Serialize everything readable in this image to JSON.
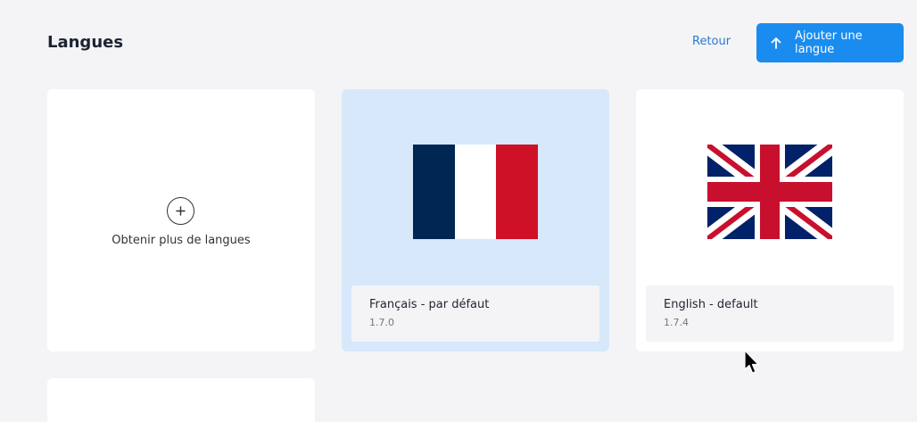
{
  "header": {
    "title": "Langues",
    "back_label": "Retour",
    "add_label": "Ajouter une langue"
  },
  "get_more": {
    "label": "Obtenir plus de langues"
  },
  "languages": [
    {
      "name": "Français - par défaut",
      "version": "1.7.0",
      "selected": true,
      "flag": "france-flag"
    },
    {
      "name": "English - default",
      "version": "1.7.4",
      "selected": false,
      "flag": "uk-flag"
    }
  ],
  "colors": {
    "accent": "#1a8cf0",
    "link": "#2c7bc9",
    "selected_card": "#d7e8fa",
    "background": "#f4f4f7"
  }
}
